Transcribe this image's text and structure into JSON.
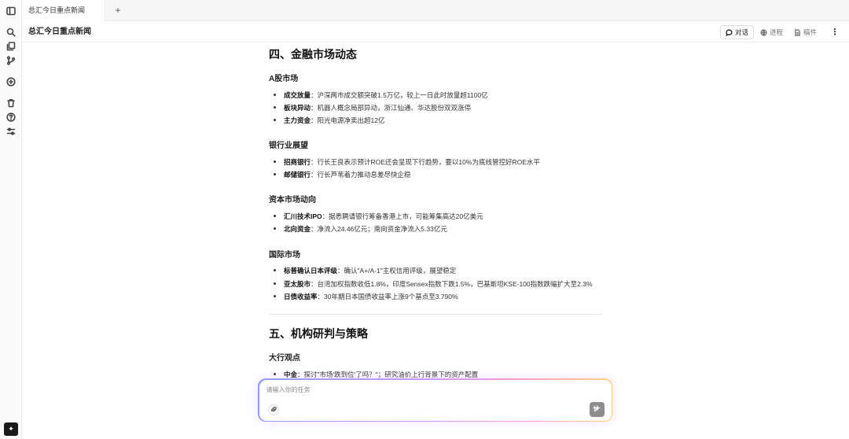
{
  "tab": {
    "title": "总汇今日重点新闻",
    "add_label": "+"
  },
  "header": {
    "title": "总汇今日重点新闻",
    "modes": [
      {
        "label": "对话",
        "icon": "chat-bubble-icon",
        "active": true
      },
      {
        "label": "进程",
        "icon": "globe-icon",
        "active": false
      },
      {
        "label": "稿件",
        "icon": "document-icon",
        "active": false
      }
    ],
    "more_label": "⋮"
  },
  "sidebar": {
    "icons": [
      "panel-toggle-icon",
      "search-icon",
      "copy-icon",
      "branch-icon",
      "chat-add-icon",
      "trash-icon",
      "help-icon",
      "settings-sliders-icon"
    ],
    "logo_icon": "app-logo-icon"
  },
  "doc": {
    "section4": {
      "title": "四、金融市场动态",
      "groups": [
        {
          "title": "A股市场",
          "items": [
            {
              "key": "成交放量",
              "text": "：沪深两市成交额突破1.5万亿，较上一日此时放量超1100亿"
            },
            {
              "key": "板块异动",
              "text": "：机器人概念局部异动，浙江仙通、华达股份双双涨停"
            },
            {
              "key": "主力资金",
              "text": "：阳光电源净卖出超12亿"
            }
          ]
        },
        {
          "title": "银行业展望",
          "items": [
            {
              "key": "招商银行",
              "text": "：行长王良表示预计ROE还会呈现下行趋势，要以10%为底线管控好ROE水平"
            },
            {
              "key": "邮储银行",
              "text": "：行长芦苇着力推动息差尽快企稳"
            }
          ]
        },
        {
          "title": "资本市场动向",
          "items": [
            {
              "key": "汇川技术IPO",
              "text": "：据悉聘请银行筹备香港上市，可能筹集高达20亿美元"
            },
            {
              "key": "北向资金",
              "text": "：净流入24.46亿元；南向资金净流入5.33亿元"
            }
          ]
        },
        {
          "title": "国际市场",
          "items": [
            {
              "key": "标普确认日本评级",
              "text": "：确认\"A+/A-1\"主权信用评级，展望稳定"
            },
            {
              "key": "亚太股市",
              "text": "：台湾加权指数收低1.8%，印度Sensex指数下跌1.5%，巴基斯坦KSE-100指数跌幅扩大至2.3%"
            },
            {
              "key": "日债收益率",
              "text": "：30年期日本国债收益率上涨9个基点至3.790%"
            }
          ]
        }
      ]
    },
    "section5": {
      "title": "五、机构研判与策略",
      "groups": [
        {
          "title": "大行观点",
          "items": [
            {
              "key": "中金",
              "text": "：探讨\"市场'跌到位'了吗？\"；研究油价上行背景下的资产配置"
            }
          ]
        }
      ]
    }
  },
  "composer": {
    "placeholder": "请输入你的任务",
    "attach_icon": "paperclip-icon",
    "send_icon": "send-sparkle-icon"
  }
}
